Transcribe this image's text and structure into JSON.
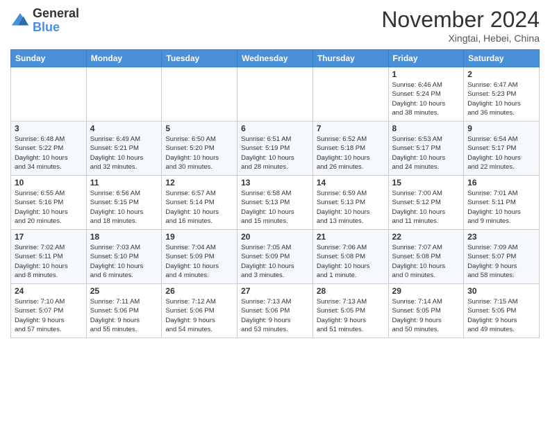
{
  "logo": {
    "general": "General",
    "blue": "Blue"
  },
  "header": {
    "month": "November 2024",
    "location": "Xingtai, Hebei, China"
  },
  "weekdays": [
    "Sunday",
    "Monday",
    "Tuesday",
    "Wednesday",
    "Thursday",
    "Friday",
    "Saturday"
  ],
  "weeks": [
    [
      {
        "day": "",
        "info": ""
      },
      {
        "day": "",
        "info": ""
      },
      {
        "day": "",
        "info": ""
      },
      {
        "day": "",
        "info": ""
      },
      {
        "day": "",
        "info": ""
      },
      {
        "day": "1",
        "info": "Sunrise: 6:46 AM\nSunset: 5:24 PM\nDaylight: 10 hours\nand 38 minutes."
      },
      {
        "day": "2",
        "info": "Sunrise: 6:47 AM\nSunset: 5:23 PM\nDaylight: 10 hours\nand 36 minutes."
      }
    ],
    [
      {
        "day": "3",
        "info": "Sunrise: 6:48 AM\nSunset: 5:22 PM\nDaylight: 10 hours\nand 34 minutes."
      },
      {
        "day": "4",
        "info": "Sunrise: 6:49 AM\nSunset: 5:21 PM\nDaylight: 10 hours\nand 32 minutes."
      },
      {
        "day": "5",
        "info": "Sunrise: 6:50 AM\nSunset: 5:20 PM\nDaylight: 10 hours\nand 30 minutes."
      },
      {
        "day": "6",
        "info": "Sunrise: 6:51 AM\nSunset: 5:19 PM\nDaylight: 10 hours\nand 28 minutes."
      },
      {
        "day": "7",
        "info": "Sunrise: 6:52 AM\nSunset: 5:18 PM\nDaylight: 10 hours\nand 26 minutes."
      },
      {
        "day": "8",
        "info": "Sunrise: 6:53 AM\nSunset: 5:17 PM\nDaylight: 10 hours\nand 24 minutes."
      },
      {
        "day": "9",
        "info": "Sunrise: 6:54 AM\nSunset: 5:17 PM\nDaylight: 10 hours\nand 22 minutes."
      }
    ],
    [
      {
        "day": "10",
        "info": "Sunrise: 6:55 AM\nSunset: 5:16 PM\nDaylight: 10 hours\nand 20 minutes."
      },
      {
        "day": "11",
        "info": "Sunrise: 6:56 AM\nSunset: 5:15 PM\nDaylight: 10 hours\nand 18 minutes."
      },
      {
        "day": "12",
        "info": "Sunrise: 6:57 AM\nSunset: 5:14 PM\nDaylight: 10 hours\nand 16 minutes."
      },
      {
        "day": "13",
        "info": "Sunrise: 6:58 AM\nSunset: 5:13 PM\nDaylight: 10 hours\nand 15 minutes."
      },
      {
        "day": "14",
        "info": "Sunrise: 6:59 AM\nSunset: 5:13 PM\nDaylight: 10 hours\nand 13 minutes."
      },
      {
        "day": "15",
        "info": "Sunrise: 7:00 AM\nSunset: 5:12 PM\nDaylight: 10 hours\nand 11 minutes."
      },
      {
        "day": "16",
        "info": "Sunrise: 7:01 AM\nSunset: 5:11 PM\nDaylight: 10 hours\nand 9 minutes."
      }
    ],
    [
      {
        "day": "17",
        "info": "Sunrise: 7:02 AM\nSunset: 5:11 PM\nDaylight: 10 hours\nand 8 minutes."
      },
      {
        "day": "18",
        "info": "Sunrise: 7:03 AM\nSunset: 5:10 PM\nDaylight: 10 hours\nand 6 minutes."
      },
      {
        "day": "19",
        "info": "Sunrise: 7:04 AM\nSunset: 5:09 PM\nDaylight: 10 hours\nand 4 minutes."
      },
      {
        "day": "20",
        "info": "Sunrise: 7:05 AM\nSunset: 5:09 PM\nDaylight: 10 hours\nand 3 minutes."
      },
      {
        "day": "21",
        "info": "Sunrise: 7:06 AM\nSunset: 5:08 PM\nDaylight: 10 hours\nand 1 minute."
      },
      {
        "day": "22",
        "info": "Sunrise: 7:07 AM\nSunset: 5:08 PM\nDaylight: 10 hours\nand 0 minutes."
      },
      {
        "day": "23",
        "info": "Sunrise: 7:09 AM\nSunset: 5:07 PM\nDaylight: 9 hours\nand 58 minutes."
      }
    ],
    [
      {
        "day": "24",
        "info": "Sunrise: 7:10 AM\nSunset: 5:07 PM\nDaylight: 9 hours\nand 57 minutes."
      },
      {
        "day": "25",
        "info": "Sunrise: 7:11 AM\nSunset: 5:06 PM\nDaylight: 9 hours\nand 55 minutes."
      },
      {
        "day": "26",
        "info": "Sunrise: 7:12 AM\nSunset: 5:06 PM\nDaylight: 9 hours\nand 54 minutes."
      },
      {
        "day": "27",
        "info": "Sunrise: 7:13 AM\nSunset: 5:06 PM\nDaylight: 9 hours\nand 53 minutes."
      },
      {
        "day": "28",
        "info": "Sunrise: 7:13 AM\nSunset: 5:05 PM\nDaylight: 9 hours\nand 51 minutes."
      },
      {
        "day": "29",
        "info": "Sunrise: 7:14 AM\nSunset: 5:05 PM\nDaylight: 9 hours\nand 50 minutes."
      },
      {
        "day": "30",
        "info": "Sunrise: 7:15 AM\nSunset: 5:05 PM\nDaylight: 9 hours\nand 49 minutes."
      }
    ]
  ]
}
